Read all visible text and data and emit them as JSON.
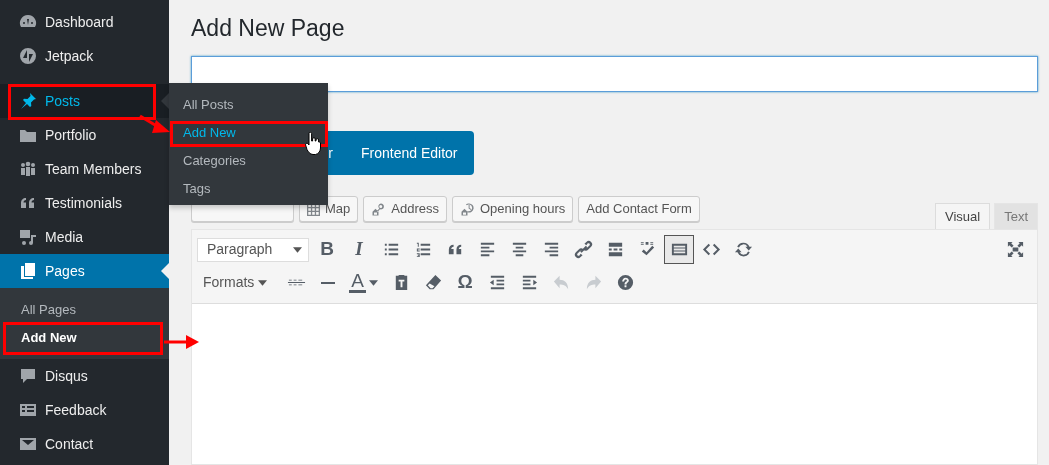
{
  "sidebar": {
    "items": [
      {
        "label": "Dashboard",
        "selected": false,
        "expanded": false,
        "annotated": false
      },
      {
        "label": "Jetpack",
        "selected": false,
        "expanded": false,
        "annotated": false
      },
      {
        "label": "Posts",
        "selected": false,
        "expanded": true,
        "annotated": true
      },
      {
        "label": "Portfolio",
        "selected": false,
        "expanded": false,
        "annotated": false
      },
      {
        "label": "Team Members",
        "selected": false,
        "expanded": false,
        "annotated": false
      },
      {
        "label": "Testimonials",
        "selected": false,
        "expanded": false,
        "annotated": false
      },
      {
        "label": "Media",
        "selected": false,
        "expanded": false,
        "annotated": false
      },
      {
        "label": "Pages",
        "selected": true,
        "expanded": false,
        "annotated": false,
        "children": [
          {
            "label": "All Pages",
            "selected": false,
            "annotated": false
          },
          {
            "label": "Add New",
            "selected": true,
            "annotated": true
          }
        ]
      },
      {
        "label": "Disqus",
        "selected": false,
        "expanded": false,
        "annotated": false
      },
      {
        "label": "Feedback",
        "selected": false,
        "expanded": false,
        "annotated": false
      },
      {
        "label": "Contact",
        "selected": false,
        "expanded": false,
        "annotated": false
      }
    ]
  },
  "flyout": {
    "items": [
      {
        "label": "All Posts",
        "selected": false,
        "annotated": false
      },
      {
        "label": "Add New",
        "selected": true,
        "annotated": true
      },
      {
        "label": "Categories",
        "selected": false,
        "annotated": false
      },
      {
        "label": "Tags",
        "selected": false,
        "annotated": false
      }
    ]
  },
  "page_title": "Add New Page",
  "editor_buttons": [
    "r",
    "Frontend Editor"
  ],
  "media_buttons": [
    {
      "kind": "covered"
    },
    {
      "kind": "plain",
      "label": "Map"
    },
    {
      "kind": "plain",
      "label": "Address"
    },
    {
      "kind": "plain",
      "label": "Opening hours"
    },
    {
      "kind": "plain",
      "label": "Add Contact Form"
    }
  ],
  "editor_tabs": [
    {
      "label": "Visual",
      "selected": true
    },
    {
      "label": "Text",
      "selected": false
    }
  ],
  "toolbar": {
    "rows": [
      [
        {
          "kind": "select",
          "label": "Paragraph"
        },
        {
          "kind": "bold",
          "text": "B"
        },
        {
          "kind": "italic",
          "text": "I"
        },
        {
          "kind": "icon"
        },
        {
          "kind": "icon"
        },
        {
          "kind": "icon"
        },
        {
          "kind": "icon"
        },
        {
          "kind": "icon"
        },
        {
          "kind": "icon"
        },
        {
          "kind": "icon"
        },
        {
          "kind": "icon"
        },
        {
          "kind": "icon"
        },
        {
          "kind": "icon",
          "pressed": true
        },
        {
          "kind": "icon"
        },
        {
          "kind": "icon"
        },
        {
          "kind": "icon"
        }
      ],
      [
        {
          "kind": "menu",
          "label": "Formats"
        },
        {
          "kind": "icon"
        },
        {
          "kind": "icon"
        },
        {
          "kind": "split",
          "text": "A"
        },
        {
          "kind": "icon"
        },
        {
          "kind": "icon"
        },
        {
          "kind": "glyph",
          "text": "Ω"
        },
        {
          "kind": "icon"
        },
        {
          "kind": "icon"
        },
        {
          "kind": "icon",
          "disabled": true
        },
        {
          "kind": "icon",
          "disabled": true
        },
        {
          "kind": "icon"
        }
      ]
    ]
  },
  "cursor": {
    "kind": "hand"
  }
}
